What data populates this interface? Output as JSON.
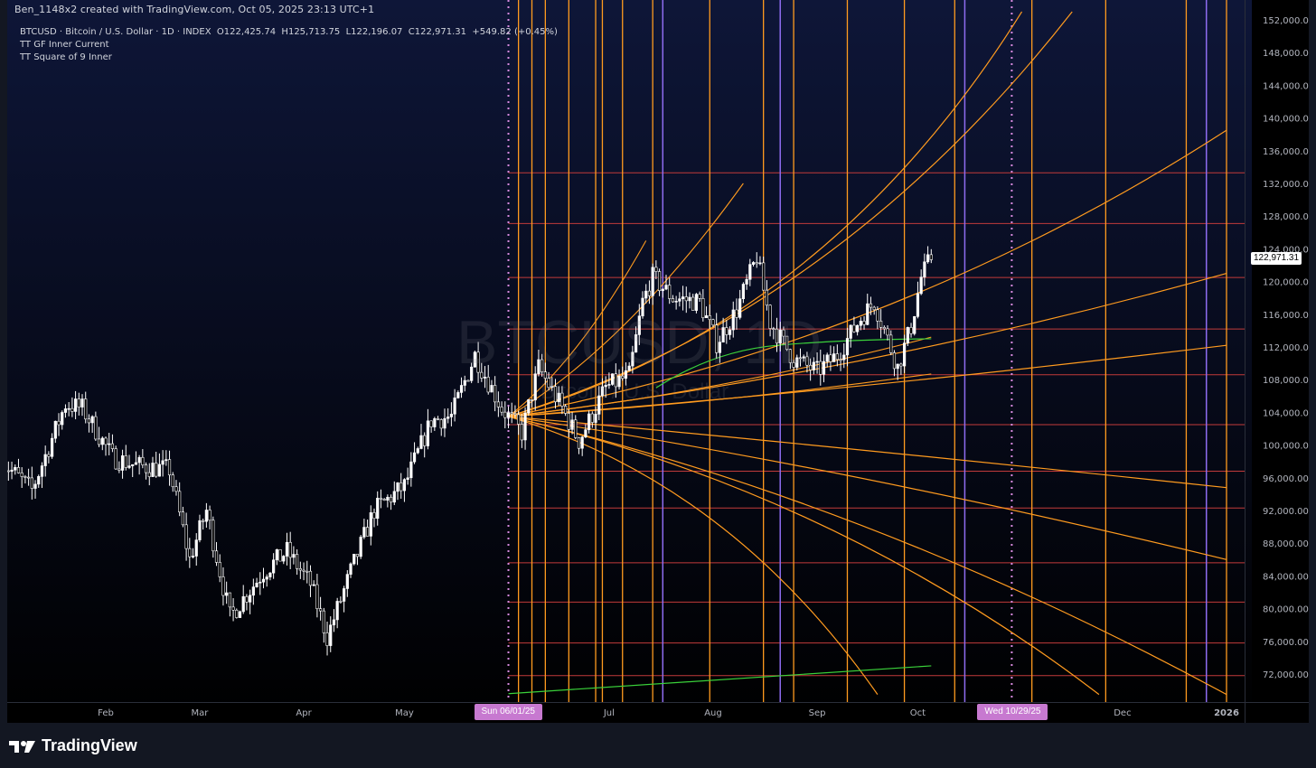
{
  "header": {
    "attribution": "Ben_1148x2 created with TradingView.com, Oct 05, 2025 23:13 UTC+1"
  },
  "legend": {
    "symbol_line": "BTCUSD · Bitcoin / U.S. Dollar · 1D · INDEX",
    "o_label": "O",
    "open": "122,425.74",
    "h_label": "H",
    "high": "125,713.75",
    "l_label": "L",
    "low": "122,196.07",
    "c_label": "C",
    "close": "122,971.31",
    "change": "+549.82 (+0.45%)",
    "indicators": [
      "TT GF Inner Current",
      "TT Square of 9 Inner"
    ]
  },
  "watermark": {
    "symbol": "BTCUSD, 1D",
    "name": "Bitcoin / U.S. Dollar"
  },
  "footer": {
    "brand": "TradingView"
  },
  "colors": {
    "background": "#000000",
    "candle": "#ffffff",
    "orange": "#ff9b1f",
    "purple": "#8e6cf0",
    "pink": "#d78adf",
    "red_level": "#c23b3b",
    "green_ma": "#3ad13a"
  },
  "chart_data": {
    "type": "candlestick",
    "symbol": "BTCUSD",
    "interval": "1D",
    "y_axis": {
      "ylim": [
        69500,
        152500
      ],
      "ticks": [
        72000,
        76000,
        80000,
        84000,
        88000,
        92000,
        96000,
        100000,
        104000,
        108000,
        112000,
        116000,
        120000,
        124000,
        128000,
        132000,
        136000,
        140000,
        144000,
        148000,
        152000
      ],
      "tick_labels": [
        "72,000.00",
        "76,000.00",
        "80,000.00",
        "84,000.00",
        "88,000.00",
        "92,000.00",
        "96,000.00",
        "100,000.00",
        "104,000.00",
        "108,000.00",
        "112,000.00",
        "116,000.00",
        "120,000.00",
        "124,000.00",
        "128,000.00",
        "132,000.00",
        "136,000.00",
        "140,000.00",
        "144,000.00",
        "148,000.00",
        "152,000.00"
      ]
    },
    "x_axis": {
      "xlim": [
        "2025-01-01",
        "2026-01-03"
      ],
      "months": [
        {
          "label": "Feb",
          "date": "2025-02-01"
        },
        {
          "label": "Mar",
          "date": "2025-03-01"
        },
        {
          "label": "Apr",
          "date": "2025-04-01"
        },
        {
          "label": "May",
          "date": "2025-05-01"
        },
        {
          "label": "Jul",
          "date": "2025-07-01"
        },
        {
          "label": "Aug",
          "date": "2025-08-01"
        },
        {
          "label": "Sep",
          "date": "2025-09-01"
        },
        {
          "label": "Oct",
          "date": "2025-10-01"
        },
        {
          "label": "Dec",
          "date": "2025-12-01"
        },
        {
          "label": "2026",
          "date": "2026-01-01"
        }
      ],
      "highlight_dates": [
        {
          "label": "Sun 06/01/25",
          "date": "2025-06-01"
        },
        {
          "label": "Wed 10/29/25",
          "date": "2025-10-29"
        }
      ]
    },
    "last_price": 122971.31,
    "last_price_label": "122,971.31",
    "price_anchor": [
      {
        "date": "2025-01-01",
        "close": 98000
      },
      {
        "date": "2025-01-10",
        "close": 94500
      },
      {
        "date": "2025-01-20",
        "close": 105000
      },
      {
        "date": "2025-01-25",
        "close": 104500
      },
      {
        "date": "2025-02-03",
        "close": 98500
      },
      {
        "date": "2025-02-10",
        "close": 97500
      },
      {
        "date": "2025-02-20",
        "close": 97000
      },
      {
        "date": "2025-02-26",
        "close": 86000
      },
      {
        "date": "2025-03-03",
        "close": 92000
      },
      {
        "date": "2025-03-10",
        "close": 79000
      },
      {
        "date": "2025-03-20",
        "close": 84500
      },
      {
        "date": "2025-03-27",
        "close": 87000
      },
      {
        "date": "2025-04-03",
        "close": 83000
      },
      {
        "date": "2025-04-08",
        "close": 76500
      },
      {
        "date": "2025-04-15",
        "close": 84500
      },
      {
        "date": "2025-04-22",
        "close": 92000
      },
      {
        "date": "2025-05-01",
        "close": 95000
      },
      {
        "date": "2025-05-09",
        "close": 103000
      },
      {
        "date": "2025-05-15",
        "close": 103500
      },
      {
        "date": "2025-05-22",
        "close": 111000
      },
      {
        "date": "2025-05-30",
        "close": 104500
      },
      {
        "date": "2025-06-05",
        "close": 101500
      },
      {
        "date": "2025-06-10",
        "close": 109500
      },
      {
        "date": "2025-06-17",
        "close": 104500
      },
      {
        "date": "2025-06-22",
        "close": 100500
      },
      {
        "date": "2025-06-30",
        "close": 107000
      },
      {
        "date": "2025-07-07",
        "close": 108500
      },
      {
        "date": "2025-07-11",
        "close": 117500
      },
      {
        "date": "2025-07-14",
        "close": 120500
      },
      {
        "date": "2025-07-20",
        "close": 118000
      },
      {
        "date": "2025-07-28",
        "close": 117500
      },
      {
        "date": "2025-08-02",
        "close": 112500
      },
      {
        "date": "2025-08-08",
        "close": 116500
      },
      {
        "date": "2025-08-14",
        "close": 123000
      },
      {
        "date": "2025-08-18",
        "close": 115000
      },
      {
        "date": "2025-08-25",
        "close": 110500
      },
      {
        "date": "2025-09-01",
        "close": 109000
      },
      {
        "date": "2025-09-07",
        "close": 111000
      },
      {
        "date": "2025-09-14",
        "close": 115500
      },
      {
        "date": "2025-09-18",
        "close": 117500
      },
      {
        "date": "2025-09-25",
        "close": 109500
      },
      {
        "date": "2025-09-29",
        "close": 114500
      },
      {
        "date": "2025-10-02",
        "close": 120500
      },
      {
        "date": "2025-10-05",
        "close": 122971
      }
    ],
    "overlays": {
      "vertical_orange_dates": [
        "2025-06-04",
        "2025-06-08",
        "2025-06-12",
        "2025-06-19",
        "2025-06-27",
        "2025-06-29",
        "2025-07-05",
        "2025-07-14",
        "2025-07-31",
        "2025-08-16",
        "2025-08-25",
        "2025-09-10",
        "2025-09-27",
        "2025-10-12",
        "2025-11-04",
        "2025-11-26",
        "2025-12-20",
        "2026-01-01"
      ],
      "vertical_purple_dates": [
        "2025-07-17",
        "2025-08-21",
        "2025-10-15",
        "2025-12-26"
      ],
      "vertical_pink_dotted_dates": [
        "2025-06-01",
        "2025-10-29"
      ],
      "horizontal_red_levels": [
        71800,
        75800,
        80800,
        85600,
        92300,
        96800,
        102500,
        108600,
        114200,
        120500,
        127100,
        133300
      ]
    }
  }
}
